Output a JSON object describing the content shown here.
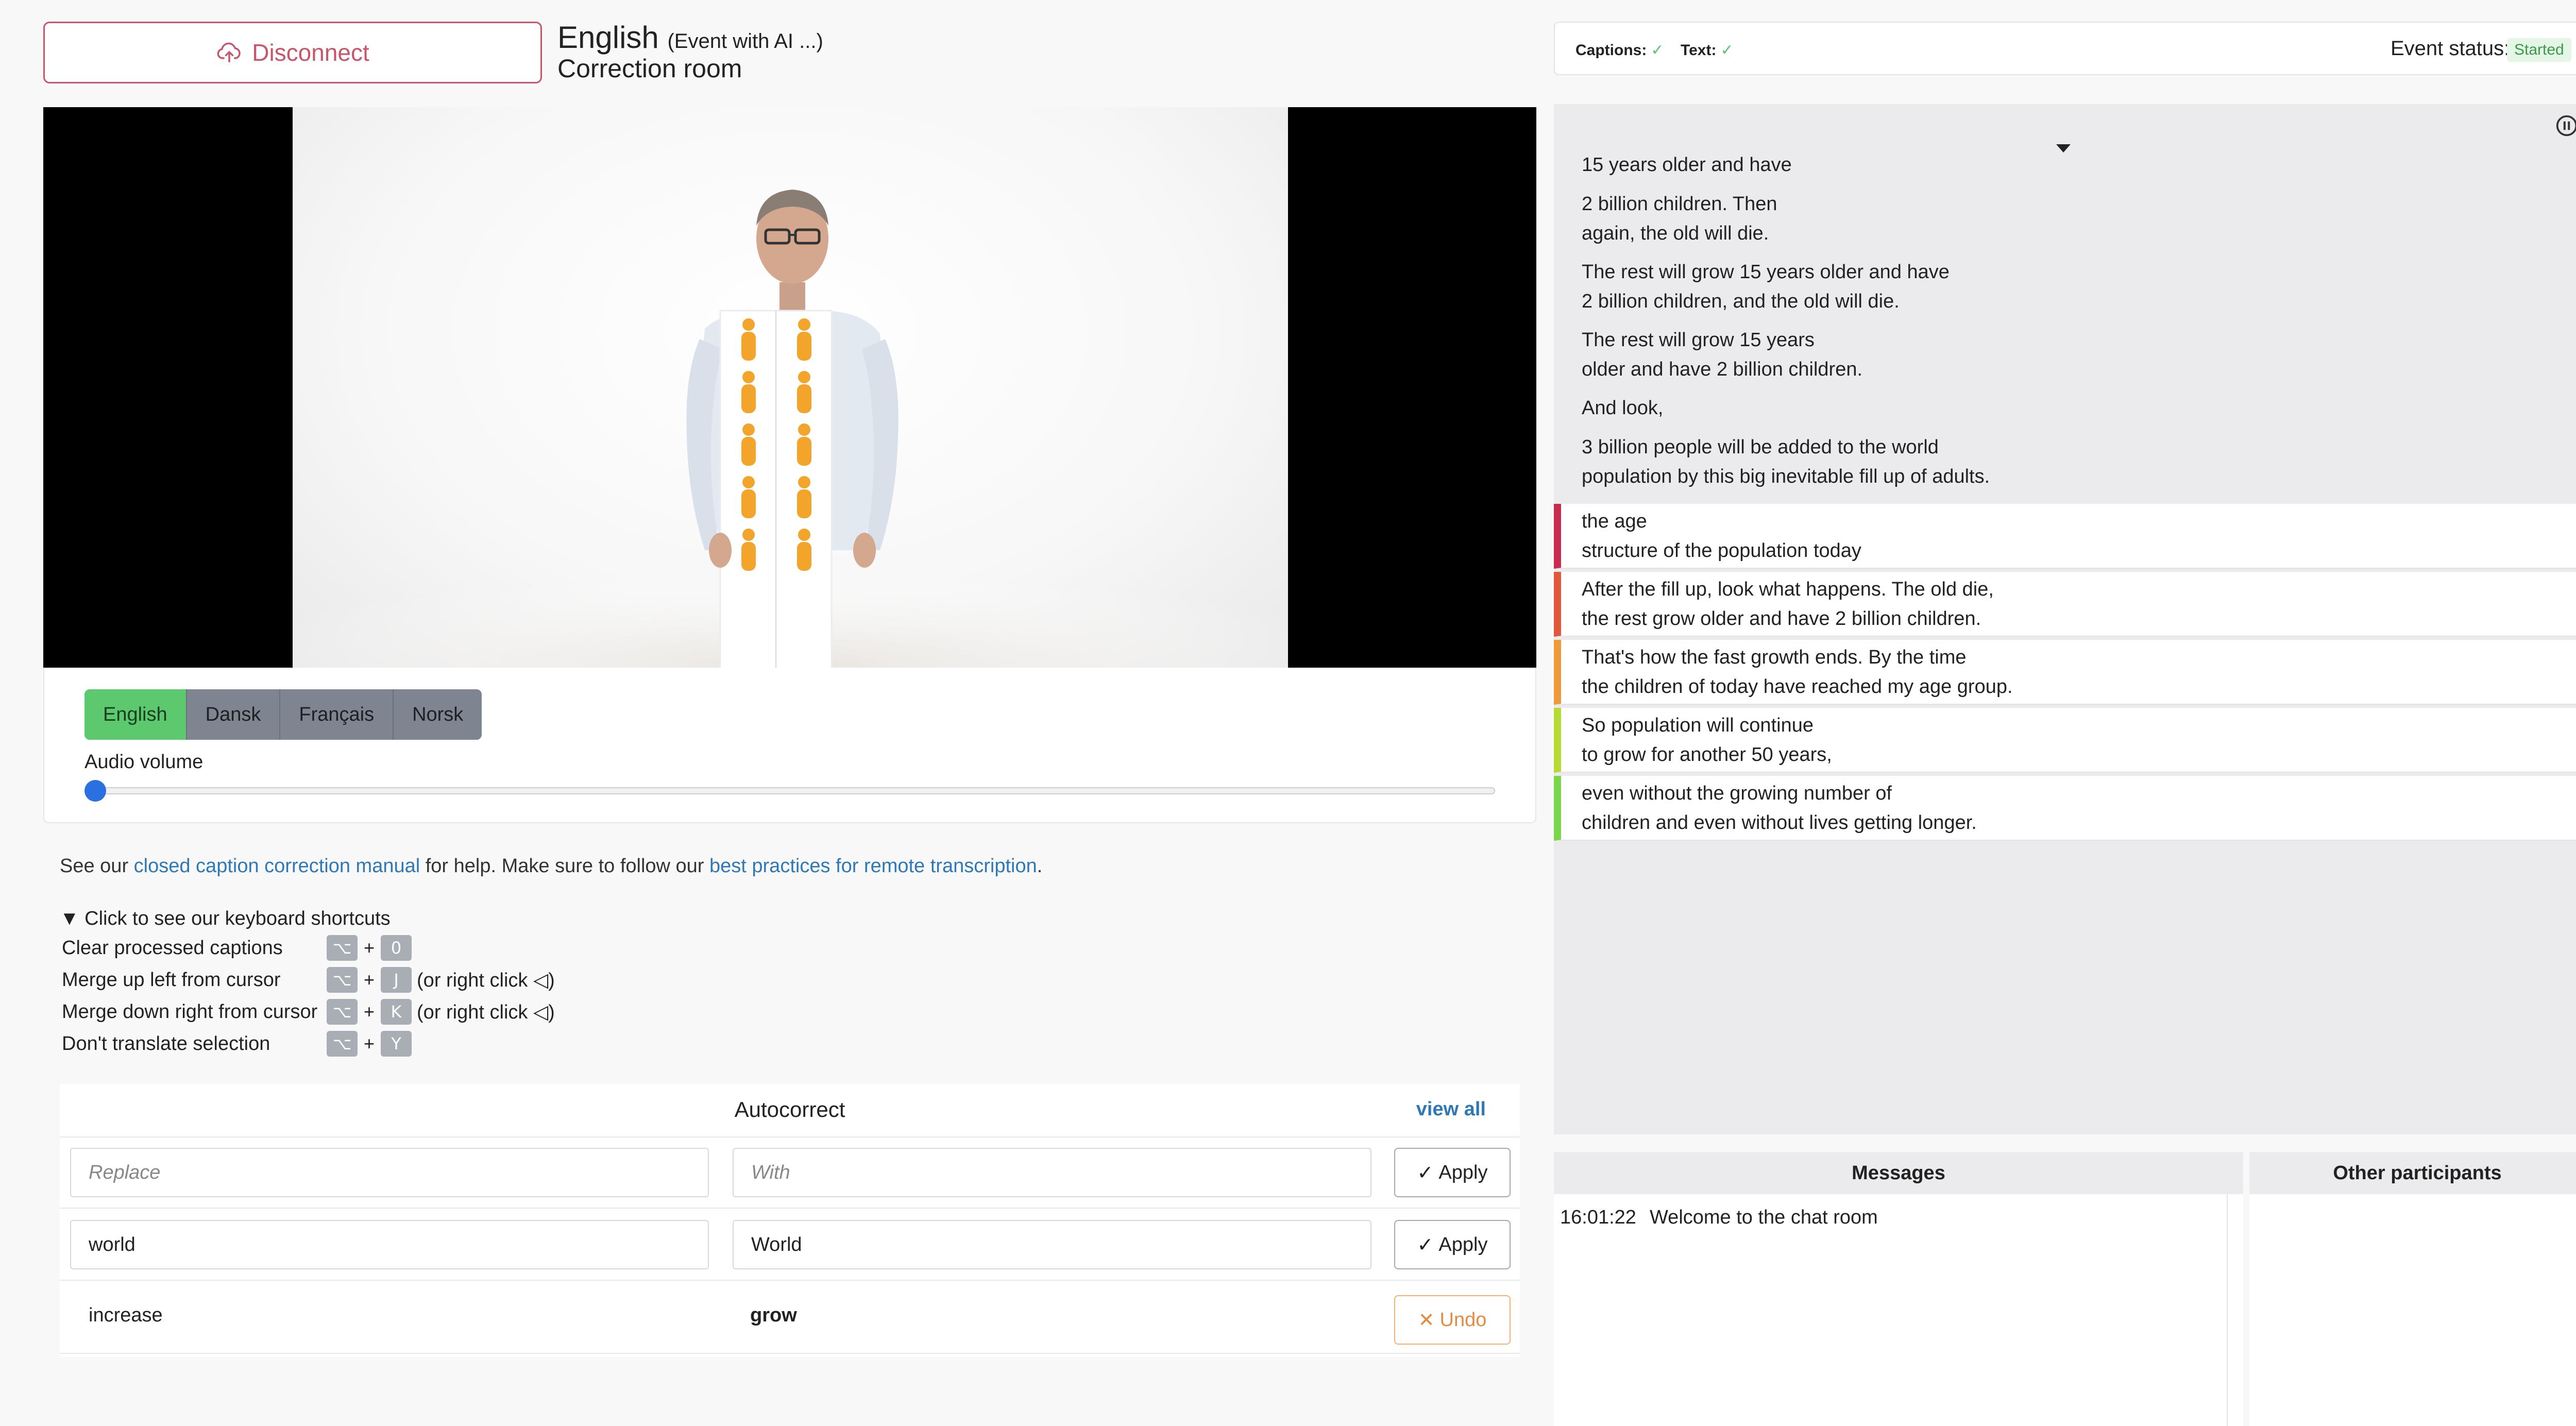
{
  "header": {
    "disconnect_label": "Disconnect",
    "event_language": "English",
    "event_subtitle": "(Event with AI ...)",
    "room_name": "Correction room"
  },
  "languages": {
    "items": [
      "English",
      "Dansk",
      "Français",
      "Norsk"
    ],
    "active": "English"
  },
  "audio": {
    "label": "Audio volume",
    "volume_fraction": 0.0
  },
  "help": {
    "prefix": "See our ",
    "manual_link": "closed caption correction manual",
    "middle": " for help. Make sure to follow our ",
    "practices_link": "best practices for remote transcription",
    "suffix": "."
  },
  "shortcuts": {
    "toggle_label": "▼ Click to see our keyboard shortcuts",
    "modifier_key": "⌥",
    "plus": "+",
    "rows": [
      {
        "label": "Clear processed captions",
        "key": "0",
        "note": ""
      },
      {
        "label": "Merge up left from cursor",
        "key": "J",
        "note": "(or right click ◁)"
      },
      {
        "label": "Merge down right from cursor",
        "key": "K",
        "note": "(or right click ◁)"
      },
      {
        "label": "Don't translate selection",
        "key": "Y",
        "note": ""
      }
    ]
  },
  "autocorrect": {
    "title": "Autocorrect",
    "view_all": "view all",
    "replace_placeholder": "Replace",
    "with_placeholder": "With",
    "apply_label": "Apply",
    "undo_label": "Undo",
    "rows": [
      {
        "replace": "world",
        "with": "World",
        "action": "Apply"
      },
      {
        "replace": "increase",
        "with": "grow",
        "action": "Undo"
      }
    ]
  },
  "status": {
    "captions_label": "Captions:",
    "text_label": "Text:",
    "check": "✓",
    "event_status_label": "Event status:",
    "event_status_value": "Started",
    "status_color": "#3a9b48"
  },
  "captions": {
    "processed": [
      [
        "15 years older and have"
      ],
      [
        "2 billion children. Then",
        "again, the old will die."
      ],
      [
        "The rest will grow 15 years older and have",
        "2 billion children, and the old will die."
      ],
      [
        "The rest will grow 15 years",
        "older and have 2 billion children."
      ],
      [
        "And look,"
      ],
      [
        "3 billion people will be added to the world",
        "population by this big inevitable fill up of adults."
      ]
    ],
    "pending": [
      {
        "lines": [
          "the age",
          "structure of the population today"
        ],
        "color": "#c82c4e"
      },
      {
        "lines": [
          "After the fill up, look what happens. The old die,",
          "the rest grow older and have 2 billion children."
        ],
        "color": "#e0573a"
      },
      {
        "lines": [
          "That's how the fast growth ends. By the time",
          "the children of today have reached my age group."
        ],
        "color": "#ee9a3c"
      },
      {
        "lines": [
          "So population will continue",
          "to grow for another 50 years,"
        ],
        "color": "#b6d934"
      },
      {
        "lines": [
          "even without the growing number of",
          "children and even without lives getting longer."
        ],
        "color": "#7ad64a"
      }
    ]
  },
  "messages": {
    "title": "Messages",
    "items": [
      {
        "time": "16:01:22",
        "text": "Welcome to the chat room"
      }
    ]
  },
  "others": {
    "title": "Other participants"
  }
}
